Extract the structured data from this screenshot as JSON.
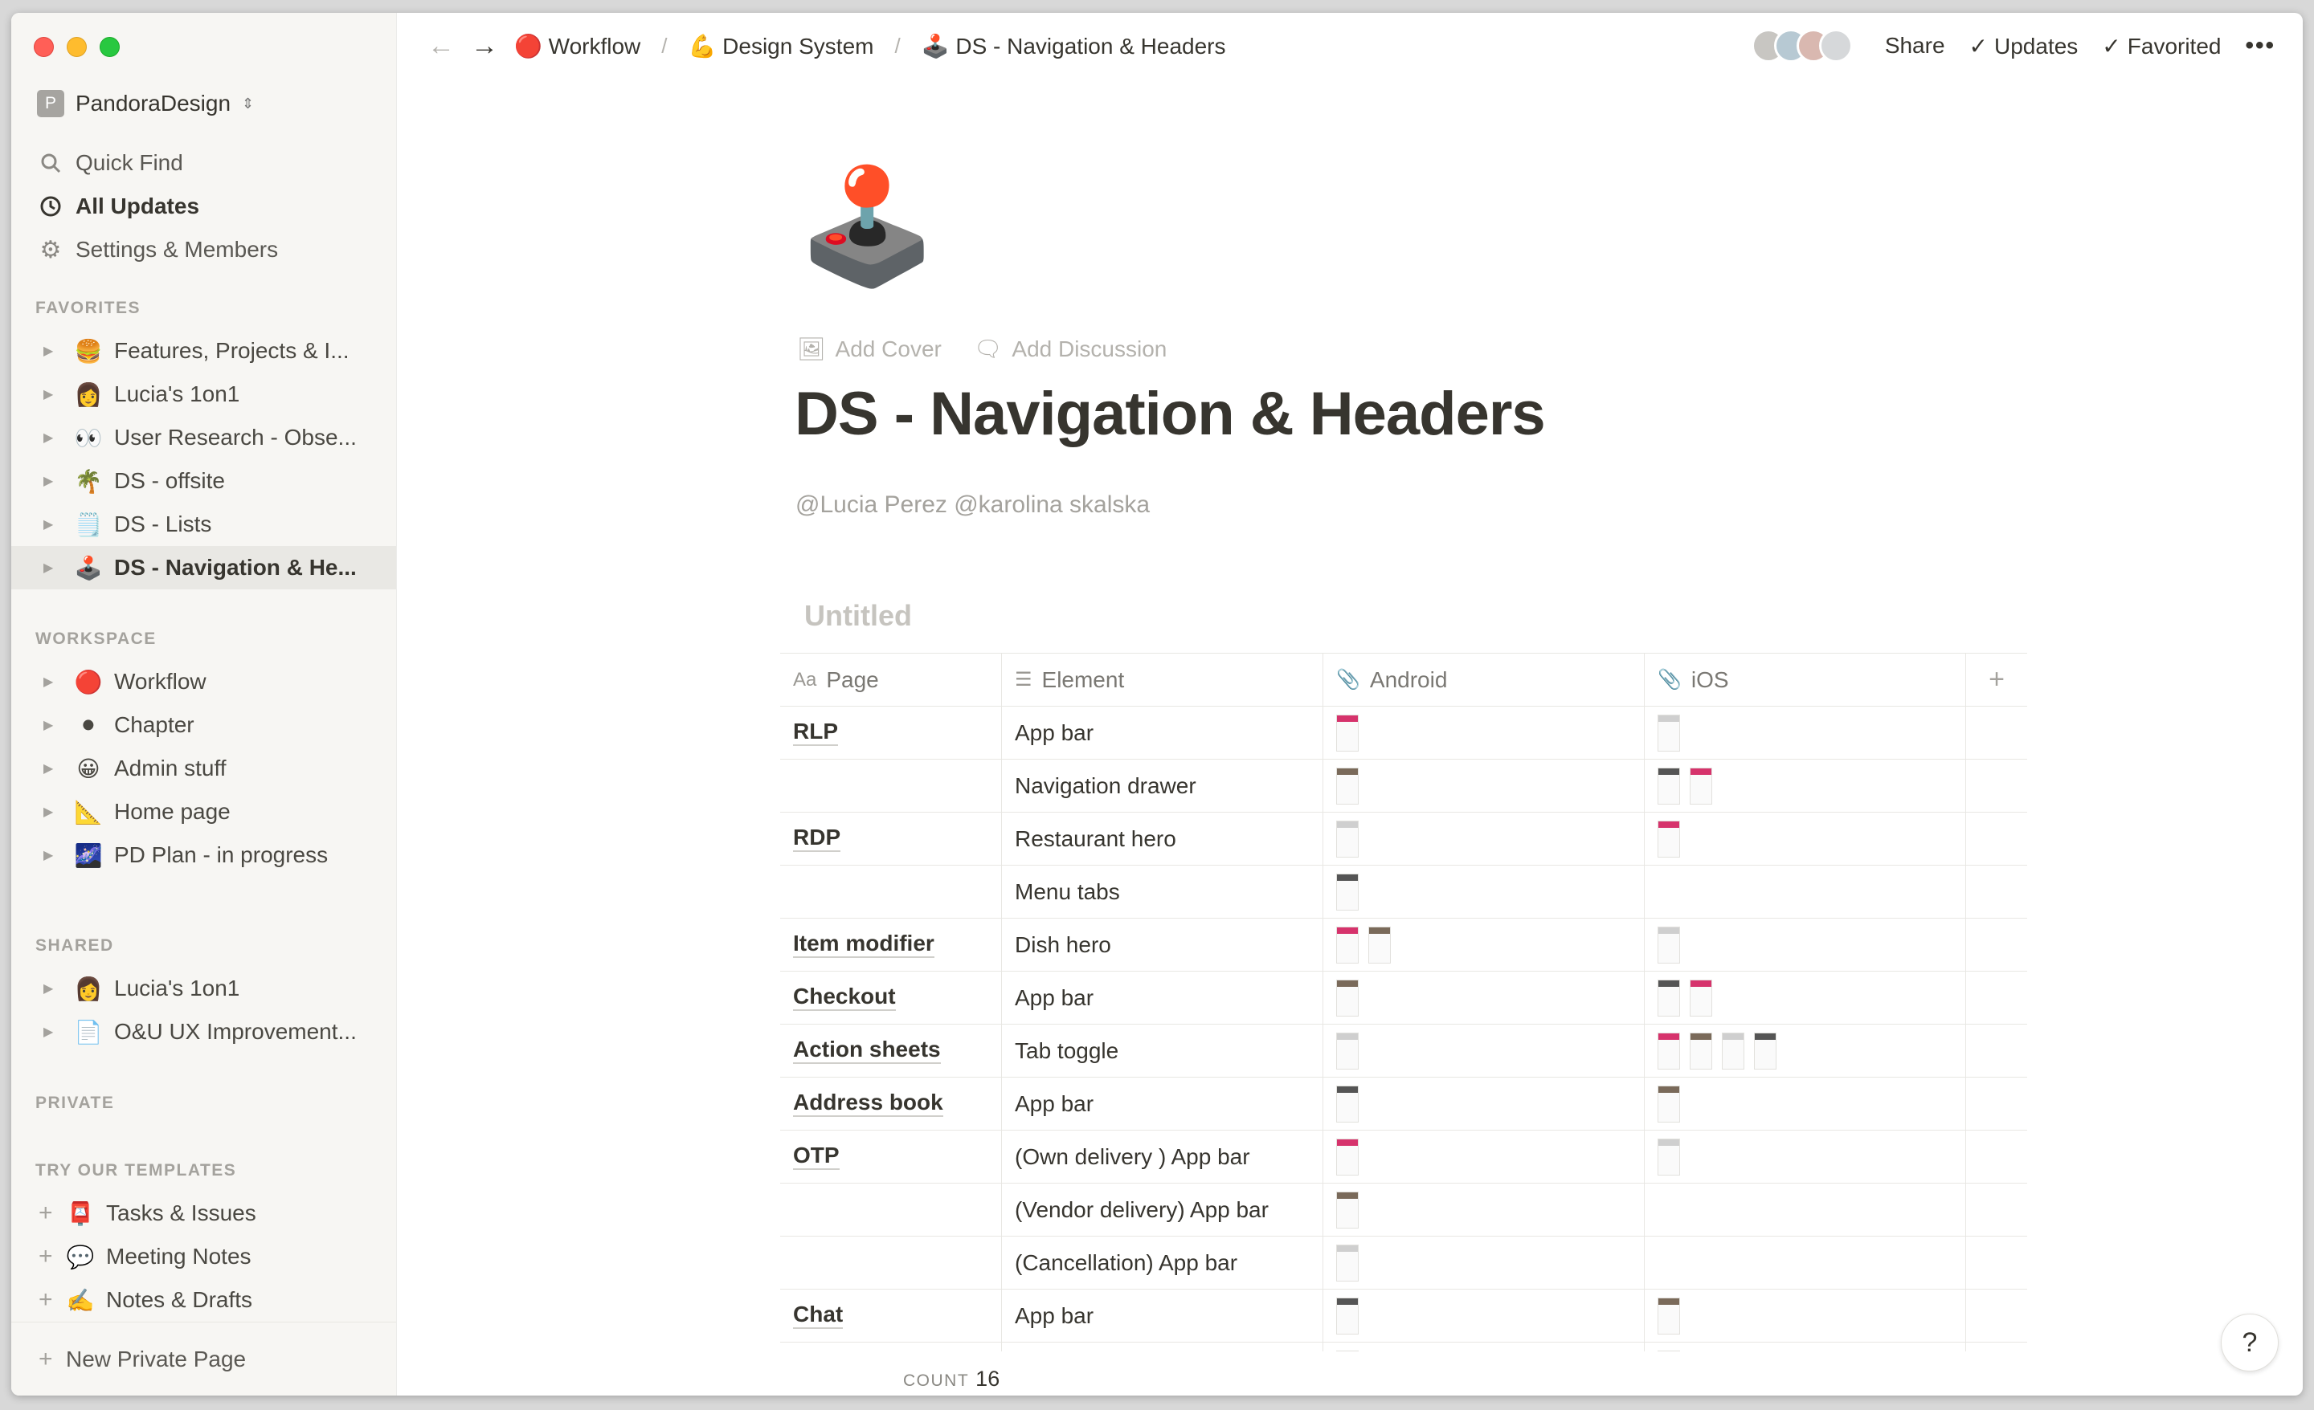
{
  "sidebar": {
    "workspace": {
      "badge": "P",
      "name": "PandoraDesign"
    },
    "nav": [
      {
        "label": "Quick Find",
        "icon": "search-icon"
      },
      {
        "label": "All Updates",
        "icon": "clock-icon"
      },
      {
        "label": "Settings & Members",
        "icon": "gear-icon"
      }
    ],
    "favorites_label": "FAVORITES",
    "favorites": [
      {
        "emoji": "🍔",
        "label": "Features, Projects & I..."
      },
      {
        "emoji": "👩",
        "label": "Lucia's 1on1"
      },
      {
        "emoji": "👀",
        "label": "User Research - Obse..."
      },
      {
        "emoji": "🌴",
        "label": "DS - offsite"
      },
      {
        "emoji": "🗒️",
        "label": "DS - Lists"
      },
      {
        "emoji": "🕹️",
        "label": "DS - Navigation & He..."
      }
    ],
    "workspace_label": "WORKSPACE",
    "workspace_pages": [
      {
        "emoji": "🔴",
        "label": "Workflow"
      },
      {
        "emoji": "⚫",
        "label": "Chapter"
      },
      {
        "emoji": "😀",
        "label": "Admin stuff"
      },
      {
        "emoji": "📐",
        "label": "Home page"
      },
      {
        "emoji": "🌌",
        "label": "PD Plan - in progress"
      }
    ],
    "shared_label": "SHARED",
    "shared": [
      {
        "emoji": "👩",
        "label": "Lucia's 1on1"
      },
      {
        "emoji": "📄",
        "label": "O&U UX Improvement..."
      }
    ],
    "private_label": "PRIVATE",
    "templates_label": "TRY OUR TEMPLATES",
    "templates": [
      {
        "emoji": "📮",
        "label": "Tasks & Issues"
      },
      {
        "emoji": "💬",
        "label": "Meeting Notes"
      },
      {
        "emoji": "✍️",
        "label": "Notes & Drafts"
      }
    ],
    "new_page": "New Private Page"
  },
  "topbar": {
    "breadcrumbs": [
      {
        "emoji": "🔴",
        "label": "Workflow"
      },
      {
        "emoji": "💪",
        "label": "Design System"
      },
      {
        "emoji": "🕹️",
        "label": "DS - Navigation & Headers"
      }
    ],
    "share": "Share",
    "updates": "Updates",
    "favorited": "Favorited"
  },
  "page": {
    "icon": "🕹️",
    "add_cover": "Add Cover",
    "add_discussion": "Add Discussion",
    "title": "DS - Navigation & Headers",
    "mentions": "@Lucia Perez @karolina skalska"
  },
  "database": {
    "title": "Untitled",
    "columns": [
      {
        "label": "Page",
        "icon": "Aa"
      },
      {
        "label": "Element",
        "icon": "☰"
      },
      {
        "label": "Android",
        "icon": "📎"
      },
      {
        "label": "iOS",
        "icon": "📎"
      }
    ],
    "rows": [
      {
        "page": "RLP",
        "element": "App bar",
        "android": 1,
        "ios": 1
      },
      {
        "page": "",
        "element": "Navigation drawer",
        "android": 1,
        "ios": 2
      },
      {
        "page": "RDP",
        "element": "Restaurant hero",
        "android": 1,
        "ios": 1
      },
      {
        "page": "",
        "element": "Menu tabs",
        "android": 1,
        "ios": 0
      },
      {
        "page": "Item modifier",
        "element": "Dish hero",
        "android": 2,
        "ios": 1
      },
      {
        "page": "Checkout",
        "element": "App bar",
        "android": 1,
        "ios": 2
      },
      {
        "page": "Action sheets",
        "element": "Tab toggle",
        "android": 1,
        "ios": 4
      },
      {
        "page": "Address book",
        "element": "App bar",
        "android": 1,
        "ios": 1
      },
      {
        "page": "OTP",
        "element": "(Own delivery ) App bar",
        "android": 1,
        "ios": 1
      },
      {
        "page": "",
        "element": "(Vendor delivery) App bar",
        "android": 1,
        "ios": 0
      },
      {
        "page": "",
        "element": "(Cancellation) App bar",
        "android": 1,
        "ios": 0
      },
      {
        "page": "Chat",
        "element": "App bar",
        "android": 1,
        "ios": 1
      },
      {
        "page": "",
        "element": "",
        "android": 1,
        "ios": 1
      }
    ],
    "count_label": "COUNT",
    "count_value": "16"
  },
  "help": "?",
  "colors": {
    "accent_pink": "#d6336c",
    "sidebar_bg": "#f7f6f3"
  }
}
